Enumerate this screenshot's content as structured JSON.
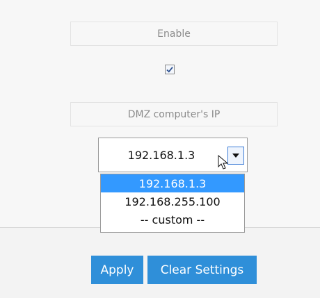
{
  "form": {
    "enable_label": "Enable",
    "enable_checked": true,
    "dmz_ip_label": "DMZ computer's IP",
    "dmz_ip_selected": "192.168.1.3",
    "dmz_ip_options": [
      "192.168.1.3",
      "192.168.255.100",
      "-- custom --"
    ]
  },
  "actions": {
    "apply_label": "Apply",
    "clear_label": "Clear Settings"
  },
  "colors": {
    "button_bg": "#2f8fd9",
    "selection_bg": "#3399ff"
  }
}
